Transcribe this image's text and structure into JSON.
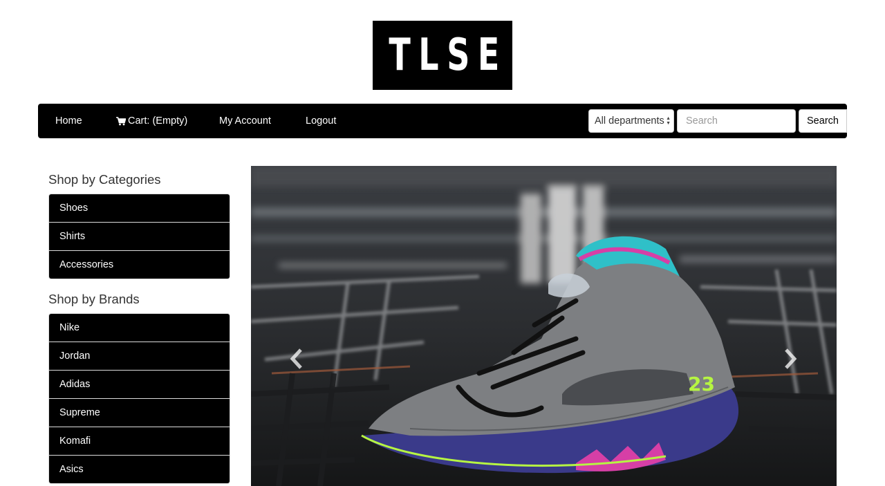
{
  "logo": {
    "text": "TLSE"
  },
  "navbar": {
    "home": "Home",
    "cart": "Cart: (Empty)",
    "account": "My Account",
    "logout": "Logout",
    "department_selected": "All departments",
    "search_placeholder": "Search",
    "search_button": "Search"
  },
  "sidebar": {
    "categories_title": "Shop by Categories",
    "categories": [
      "Shoes",
      "Shirts",
      "Accessories"
    ],
    "brands_title": "Shop by Brands",
    "brands": [
      "Nike",
      "Jordan",
      "Adidas",
      "Supreme",
      "Komafi",
      "Asics"
    ]
  },
  "carousel": {
    "prev_icon": "chevron-left-icon",
    "next_icon": "chevron-right-icon",
    "sneaker_number": "23"
  },
  "colors": {
    "brand_black": "#000000",
    "accent_pink": "#d63fa6",
    "accent_teal": "#2fc0c8",
    "accent_green": "#b6f542",
    "sole_purple": "#3a3a8a"
  }
}
